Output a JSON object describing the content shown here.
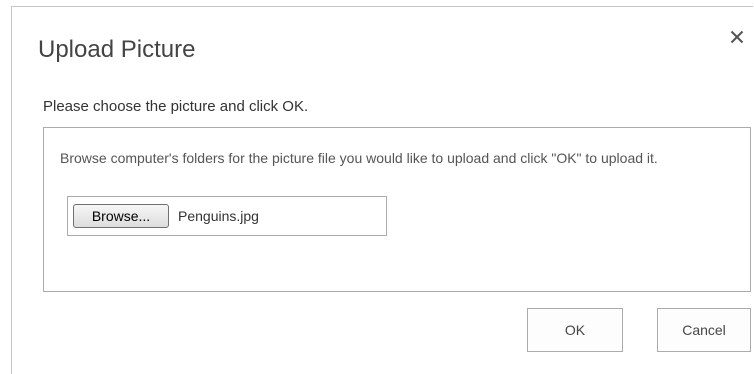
{
  "dialog": {
    "title": "Upload Picture",
    "close_icon": "close-icon",
    "instruction": "Please choose the picture and click OK.",
    "panel": {
      "description": "Browse computer's folders for the picture file you would like to upload and click \"OK\" to upload it.",
      "browse_label": "Browse...",
      "file_name": "Penguins.jpg"
    },
    "buttons": {
      "ok_label": "OK",
      "cancel_label": "Cancel"
    }
  },
  "colors": {
    "title_text": "#444444",
    "border": "#ababab"
  }
}
